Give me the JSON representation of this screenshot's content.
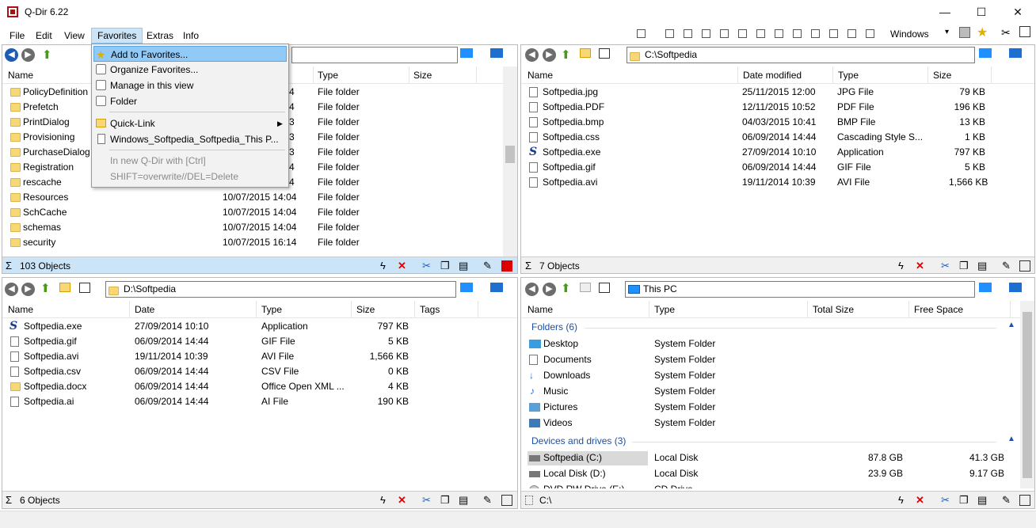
{
  "window": {
    "title": "Q-Dir 6.22",
    "min": "—",
    "max": "☐",
    "close": "✕"
  },
  "menu": [
    "File",
    "Edit",
    "View",
    "Favorites",
    "Extras",
    "Info"
  ],
  "toolbar_right": {
    "windows_label": "Windows"
  },
  "favorites_menu": {
    "items": [
      "Add to Favorites...",
      "Organize Favorites...",
      "Manage in this view",
      "Folder",
      "Quick-Link",
      "Windows_Softpedia_Softpedia_This P...",
      "In new Q-Dir with [Ctrl]",
      "SHIFT=overwrite//DEL=Delete"
    ]
  },
  "pane1": {
    "path": "",
    "headers": [
      "Name",
      "Type",
      "Size"
    ],
    "rows": [
      {
        "name": "PolicyDefinition",
        "date": "4",
        "type": "File folder"
      },
      {
        "name": "Prefetch",
        "date": "4",
        "type": "File folder"
      },
      {
        "name": "PrintDialog",
        "date": "3",
        "type": "File folder"
      },
      {
        "name": "Provisioning",
        "date": "3",
        "type": "File folder"
      },
      {
        "name": "PurchaseDialog",
        "date": "3",
        "type": "File folder"
      },
      {
        "name": "Registration",
        "date": "4",
        "type": "File folder"
      },
      {
        "name": "rescache",
        "date": "4",
        "type": "File folder"
      },
      {
        "name": "Resources",
        "date": "10/07/2015 14:04",
        "type": "File folder"
      },
      {
        "name": "SchCache",
        "date": "10/07/2015 14:04",
        "type": "File folder"
      },
      {
        "name": "schemas",
        "date": "10/07/2015 14:04",
        "type": "File folder"
      },
      {
        "name": "security",
        "date": "10/07/2015 16:14",
        "type": "File folder"
      }
    ],
    "status": "103 Objects"
  },
  "pane2": {
    "path": "C:\\Softpedia",
    "headers": [
      "Name",
      "Date modified",
      "Type",
      "Size"
    ],
    "rows": [
      {
        "name": "Softpedia.jpg",
        "date": "25/11/2015 12:00",
        "type": "JPG File",
        "size": "79 KB"
      },
      {
        "name": "Softpedia.PDF",
        "date": "12/11/2015 10:52",
        "type": "PDF File",
        "size": "196 KB"
      },
      {
        "name": "Softpedia.bmp",
        "date": "04/03/2015 10:41",
        "type": "BMP File",
        "size": "13 KB"
      },
      {
        "name": "Softpedia.css",
        "date": "06/09/2014 14:44",
        "type": "Cascading Style S...",
        "size": "1 KB"
      },
      {
        "name": "Softpedia.exe",
        "date": "27/09/2014 10:10",
        "type": "Application",
        "size": "797 KB"
      },
      {
        "name": "Softpedia.gif",
        "date": "06/09/2014 14:44",
        "type": "GIF File",
        "size": "5 KB"
      },
      {
        "name": "Softpedia.avi",
        "date": "19/11/2014 10:39",
        "type": "AVI File",
        "size": "1,566 KB"
      }
    ],
    "status": "7 Objects"
  },
  "pane3": {
    "path": "D:\\Softpedia",
    "headers": [
      "Name",
      "Date",
      "Type",
      "Size",
      "Tags"
    ],
    "rows": [
      {
        "name": "Softpedia.exe",
        "date": "27/09/2014 10:10",
        "type": "Application",
        "size": "797 KB"
      },
      {
        "name": "Softpedia.gif",
        "date": "06/09/2014 14:44",
        "type": "GIF File",
        "size": "5 KB"
      },
      {
        "name": "Softpedia.avi",
        "date": "19/11/2014 10:39",
        "type": "AVI File",
        "size": "1,566 KB"
      },
      {
        "name": "Softpedia.csv",
        "date": "06/09/2014 14:44",
        "type": "CSV File",
        "size": "0 KB"
      },
      {
        "name": "Softpedia.docx",
        "date": "06/09/2014 14:44",
        "type": "Office Open XML ...",
        "size": "4 KB"
      },
      {
        "name": "Softpedia.ai",
        "date": "06/09/2014 14:44",
        "type": "AI File",
        "size": "190 KB"
      }
    ],
    "status": "6 Objects"
  },
  "pane4": {
    "path": "This PC",
    "headers": [
      "Name",
      "Type",
      "Total Size",
      "Free Space"
    ],
    "group1": "Folders (6)",
    "folders": [
      {
        "name": "Desktop",
        "type": "System Folder"
      },
      {
        "name": "Documents",
        "type": "System Folder"
      },
      {
        "name": "Downloads",
        "type": "System Folder"
      },
      {
        "name": "Music",
        "type": "System Folder"
      },
      {
        "name": "Pictures",
        "type": "System Folder"
      },
      {
        "name": "Videos",
        "type": "System Folder"
      }
    ],
    "group2": "Devices and drives (3)",
    "drives": [
      {
        "name": "Softpedia (C:)",
        "type": "Local Disk",
        "total": "87.8 GB",
        "free": "41.3 GB"
      },
      {
        "name": "Local Disk (D:)",
        "type": "Local Disk",
        "total": "23.9 GB",
        "free": "9.17 GB"
      },
      {
        "name": "DVD RW Drive (E:)",
        "type": "CD Drive",
        "total": "",
        "free": ""
      }
    ],
    "status": "C:\\"
  }
}
